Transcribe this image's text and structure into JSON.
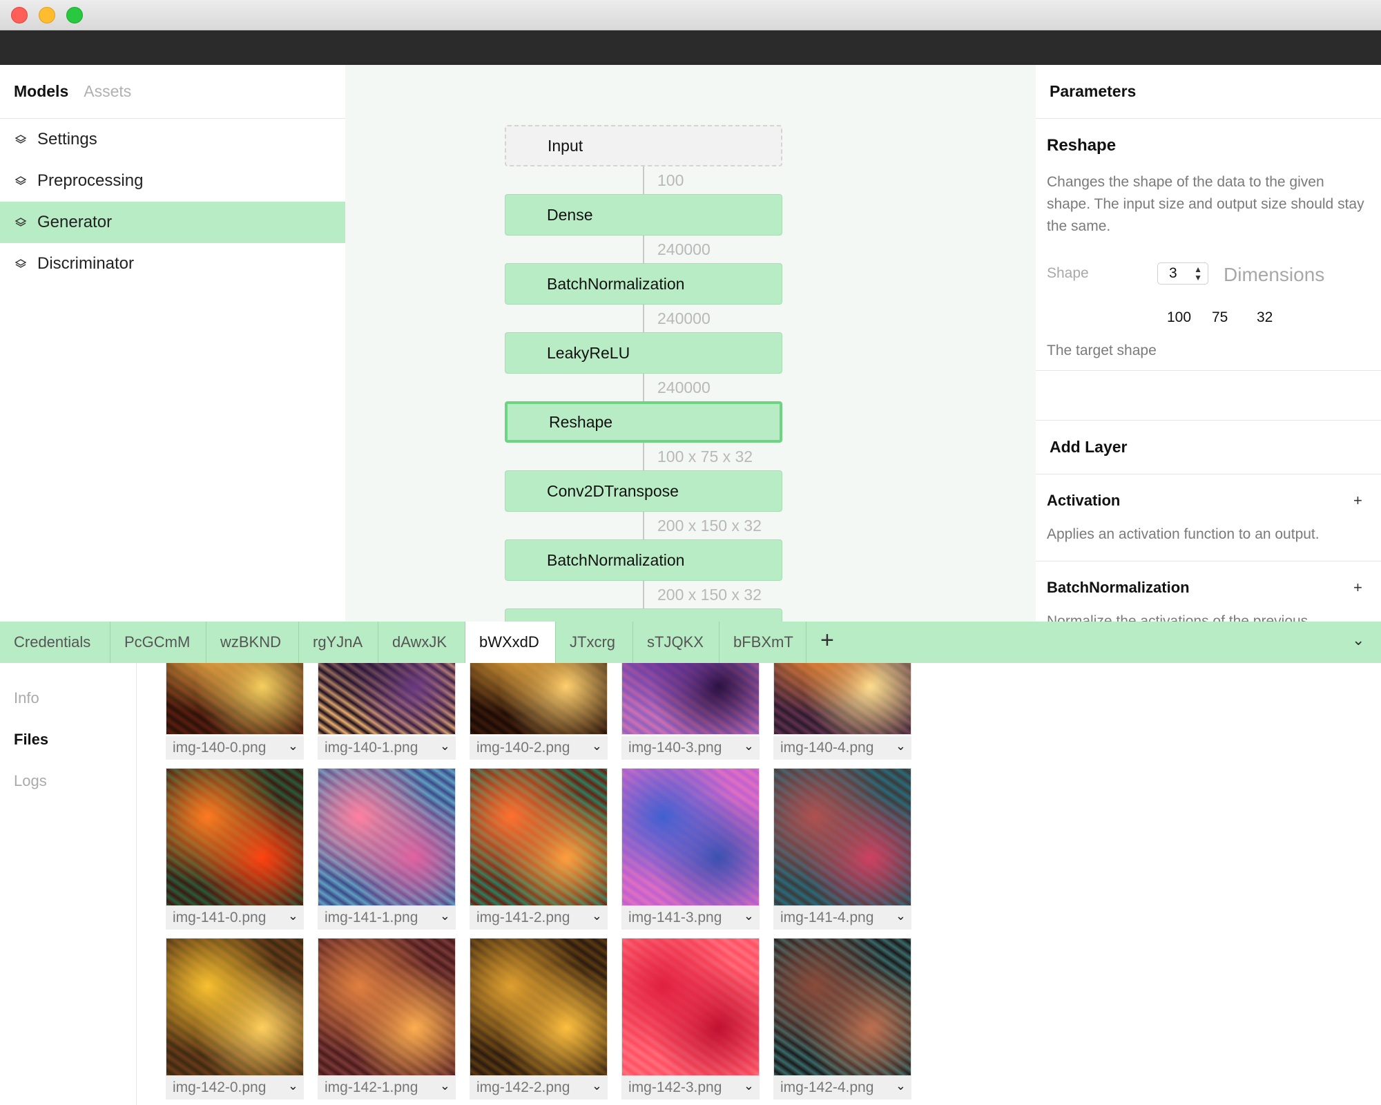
{
  "sidebar": {
    "tabs": [
      "Models",
      "Assets"
    ],
    "items": [
      "Settings",
      "Preprocessing",
      "Generator",
      "Discriminator"
    ]
  },
  "graph": {
    "nodes": [
      "Input",
      "Dense",
      "BatchNormalization",
      "LeakyReLU",
      "Reshape",
      "Conv2DTranspose",
      "BatchNormalization"
    ],
    "dims": [
      "100",
      "240000",
      "240000",
      "240000",
      "100 x 75 x 32",
      "200 x 150 x 32",
      "200 x 150 x 32"
    ]
  },
  "params": {
    "header": "Parameters",
    "title": "Reshape",
    "desc": "Changes the shape of the data to the given shape. The input size and output size should stay the same.",
    "shape_label": "Shape",
    "shape_count": "3",
    "dims_label": "Dimensions",
    "shape_values": [
      "100",
      "75",
      "32"
    ],
    "hint": "The target shape"
  },
  "add_layer": {
    "header": "Add Layer",
    "items": [
      {
        "title": "Activation",
        "desc": "Applies an activation function to an output."
      },
      {
        "title": "BatchNormalization",
        "desc": "Normalize the activations of the previous"
      }
    ],
    "plus": "+"
  },
  "tabs": {
    "items": [
      "Credentials",
      "PcGCmM",
      "wzBKND",
      "rgYJnA",
      "dAwxJK",
      "bWXxdD",
      "JTxcrg",
      "sTJQKX",
      "bFBXmT"
    ],
    "active": "bWXxdD",
    "add": "+",
    "collapse": "⌄"
  },
  "bottom_nav": [
    "Info",
    "Files",
    "Logs"
  ],
  "files": {
    "rows": [
      [
        "img-140-0.png",
        "img-140-1.png",
        "img-140-2.png",
        "img-140-3.png",
        "img-140-4.png"
      ],
      [
        "img-141-0.png",
        "img-141-1.png",
        "img-141-2.png",
        "img-141-3.png",
        "img-141-4.png"
      ],
      [
        "img-142-0.png",
        "img-142-1.png",
        "img-142-2.png",
        "img-142-3.png",
        "img-142-4.png"
      ]
    ],
    "dropdown_icon": "⌄"
  },
  "colors": {
    "accent": "#b8ecc4",
    "selected_border": "#6fd384",
    "canvas_bg": "#f4f8f5"
  }
}
